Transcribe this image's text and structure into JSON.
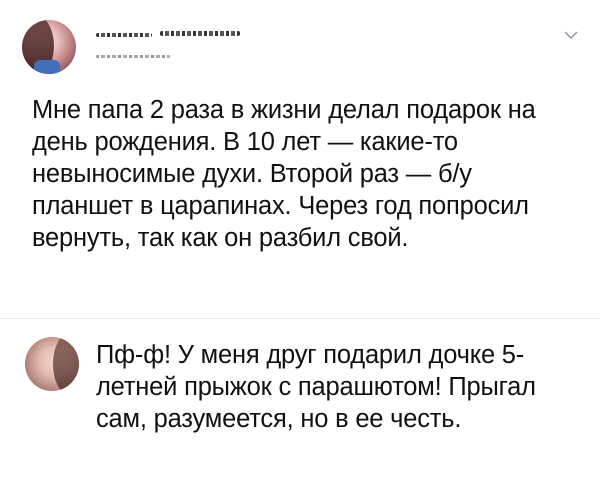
{
  "post": {
    "text": "Мне папа 2 раза в жизни делал подарок на день рождения. В 10 лет — какие-то невыносимые духи. Второй раз — б/у планшет в царапинах. Через год попросил вернуть, так как он разбил свой."
  },
  "comment": {
    "text": "Пф-ф! У меня друг подарил дочке 5-летней прыжок с парашютом! Прыгал сам, разумеется, но в ее честь."
  },
  "icons": {
    "menu": "chevron-down-icon",
    "author_avatar": "avatar",
    "commenter_avatar": "avatar"
  },
  "colors": {
    "background": "#ffffff",
    "text": "#111111",
    "divider": "#e6ecf0",
    "chevron": "#8899a6"
  }
}
